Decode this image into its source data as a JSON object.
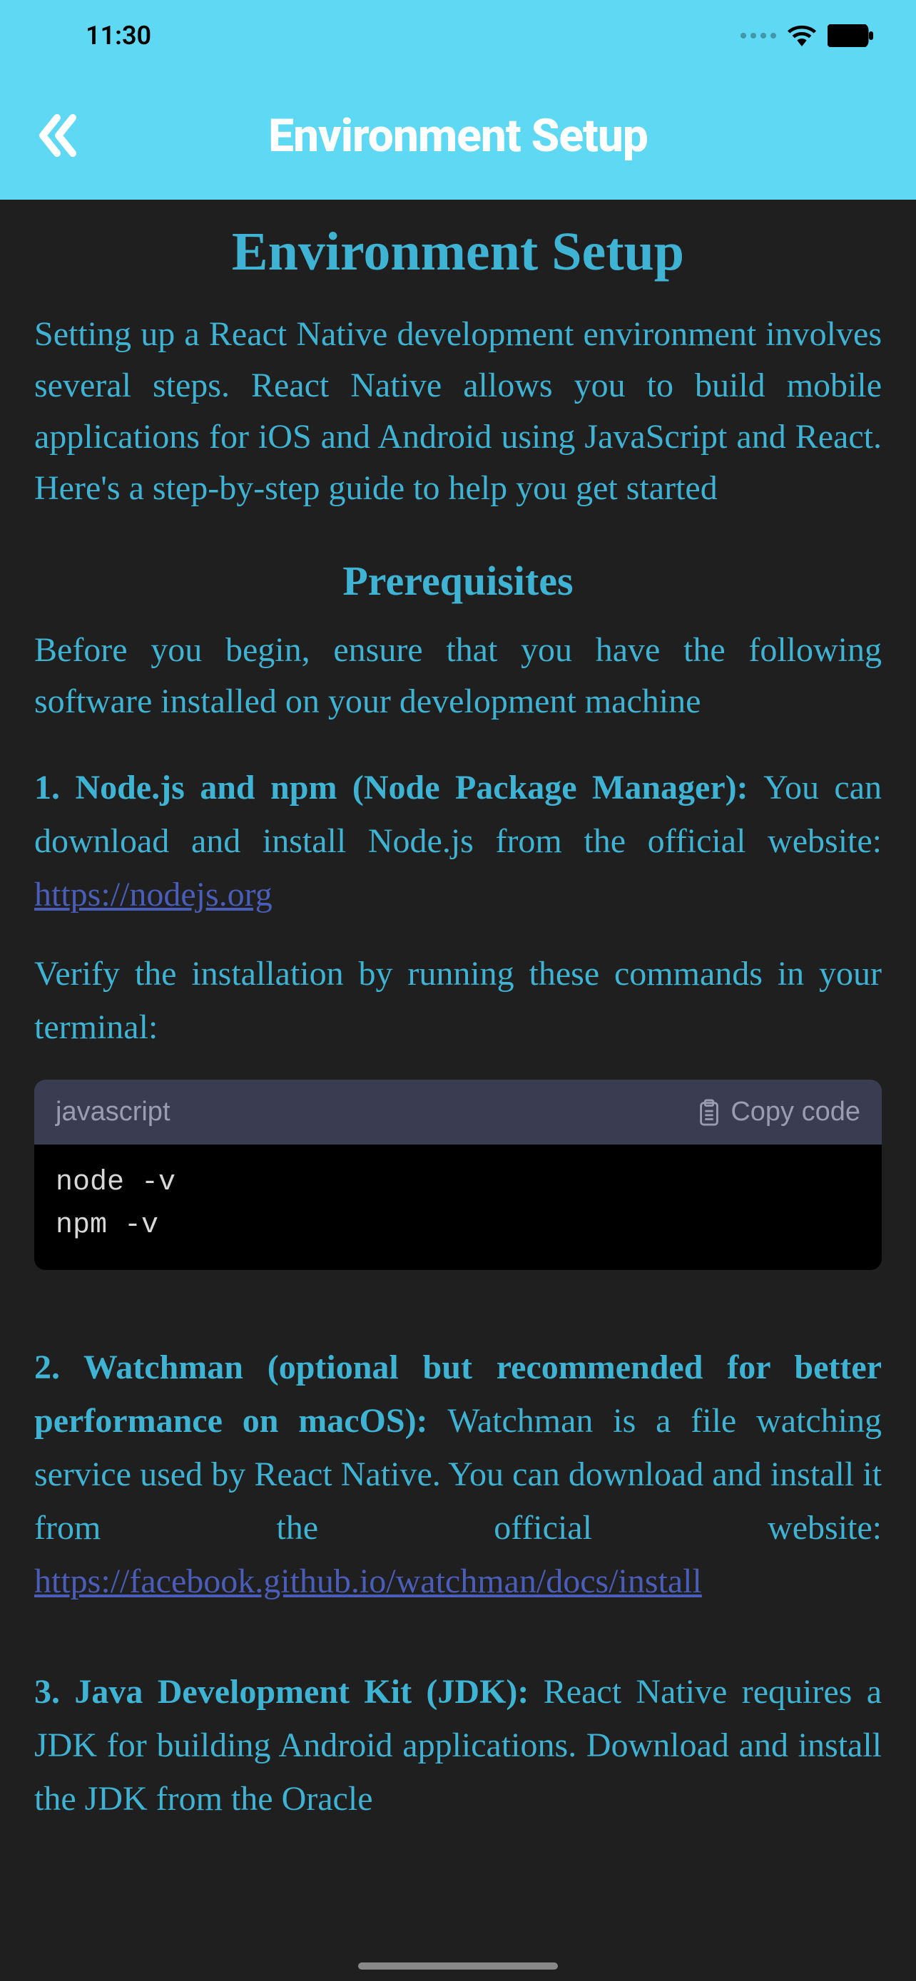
{
  "status": {
    "time": "11:30"
  },
  "nav": {
    "title": "Environment Setup"
  },
  "content": {
    "main_title": "Environment Setup",
    "intro": "Setting up a React Native development environment involves several steps. React Native allows you to build mobile applications for iOS and Android using JavaScript and React. Here's a step-by-step guide to help you get started",
    "prereq_title": "Prerequisites",
    "prereq_intro": "Before you begin, ensure that you have the following software installed on your development machine",
    "item1": {
      "label": "1. Node.js and npm (Node Package Manager): ",
      "text": "You can download and install Node.js from the official website:  ",
      "link": "https://nodejs.org"
    },
    "verify_text": "Verify the installation by running these commands in your terminal:",
    "code": {
      "lang": "javascript",
      "copy_label": "Copy code",
      "lines": [
        "node -v",
        "npm -v"
      ]
    },
    "item2": {
      "label": "2. Watchman (optional but recommended for better performance on macOS): ",
      "text": "Watchman is a file watching service used by React Native. You can download and install it from the official website: ",
      "link": "https://facebook.github.io/watchman/docs/install"
    },
    "item3": {
      "label": "3. Java Development Kit (JDK): ",
      "text": "React Native requires a JDK for building Android applications. Download and install the JDK from the Oracle"
    }
  }
}
